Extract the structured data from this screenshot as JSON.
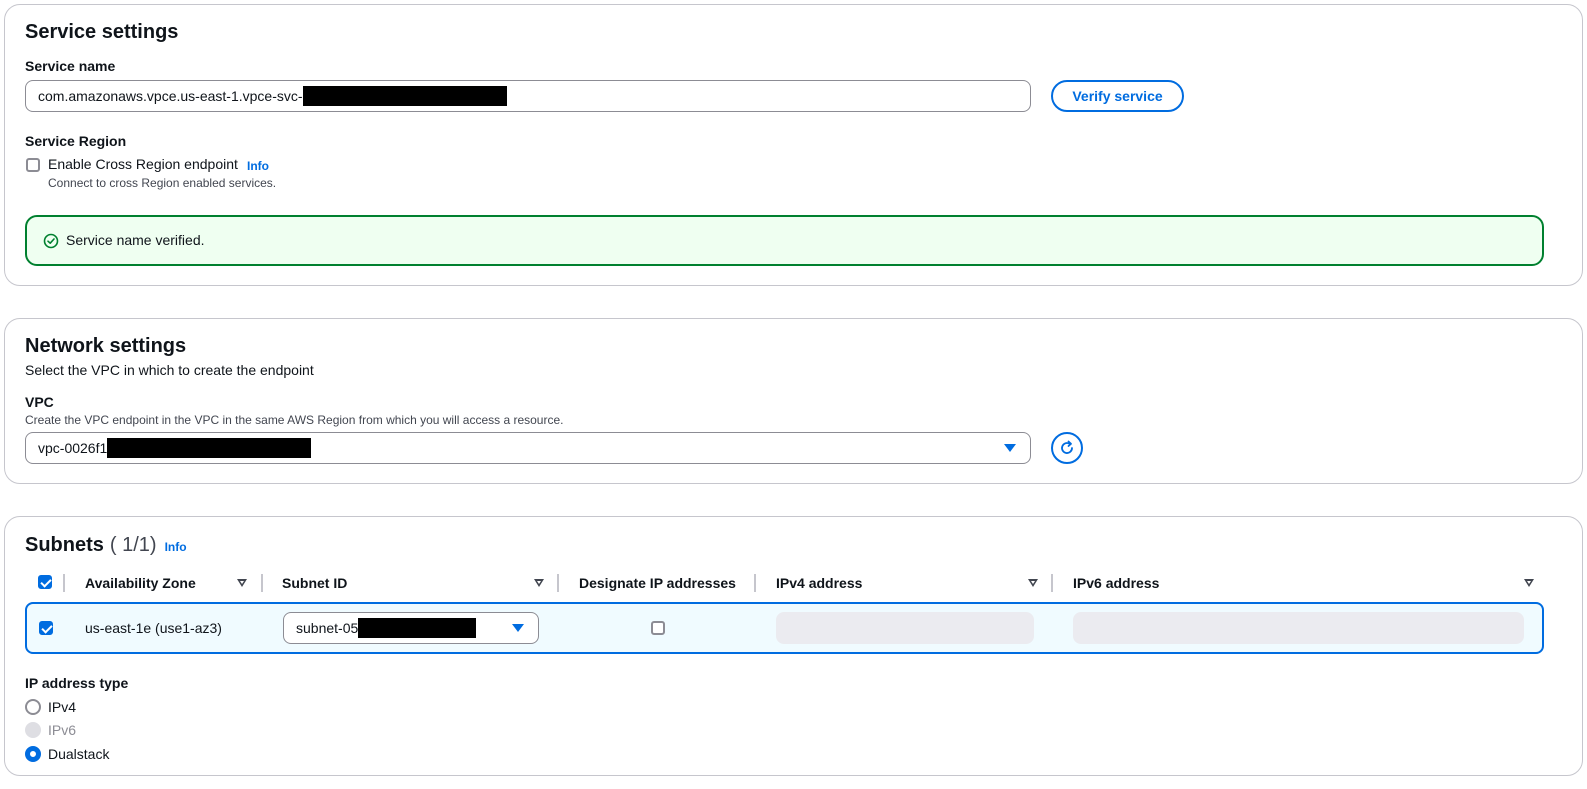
{
  "service_settings": {
    "heading": "Service settings",
    "service_name_label": "Service name",
    "service_name_value": "com.amazonaws.vpce.us-east-1.vpce-svc-",
    "verify_button": "Verify service",
    "region_label": "Service Region",
    "cross_region_checkbox_label": "Enable Cross Region endpoint",
    "cross_region_checked": false,
    "info_link": "Info",
    "cross_region_description": "Connect to cross Region enabled services.",
    "alert_message": "Service name verified."
  },
  "network_settings": {
    "heading": "Network settings",
    "description": "Select the VPC in which to create the endpoint",
    "vpc_label": "VPC",
    "vpc_description": "Create the VPC endpoint in the VPC in the same AWS Region from which you will access a resource.",
    "vpc_value": "vpc-0026f1"
  },
  "subnets": {
    "heading": "Subnets",
    "count": "( 1/1)",
    "info_link": "Info",
    "columns": [
      "Availability Zone",
      "Subnet ID",
      "Designate IP addresses",
      "IPv4 address",
      "IPv6 address"
    ],
    "rows": [
      {
        "selected": true,
        "availability_zone": "us-east-1e (use1-az3)",
        "subnet_id": "subnet-05",
        "designate_ip": false,
        "ipv4": "",
        "ipv6": ""
      }
    ],
    "ip_address_type_label": "IP address type",
    "ip_options": [
      {
        "label": "IPv4",
        "state": "unchecked"
      },
      {
        "label": "IPv6",
        "state": "disabled"
      },
      {
        "label": "Dualstack",
        "state": "checked"
      }
    ]
  },
  "colors": {
    "accent": "#006ce0",
    "success_border": "#00802f",
    "success_bg": "#effff1",
    "selected_row_bg": "#f0fbff"
  }
}
